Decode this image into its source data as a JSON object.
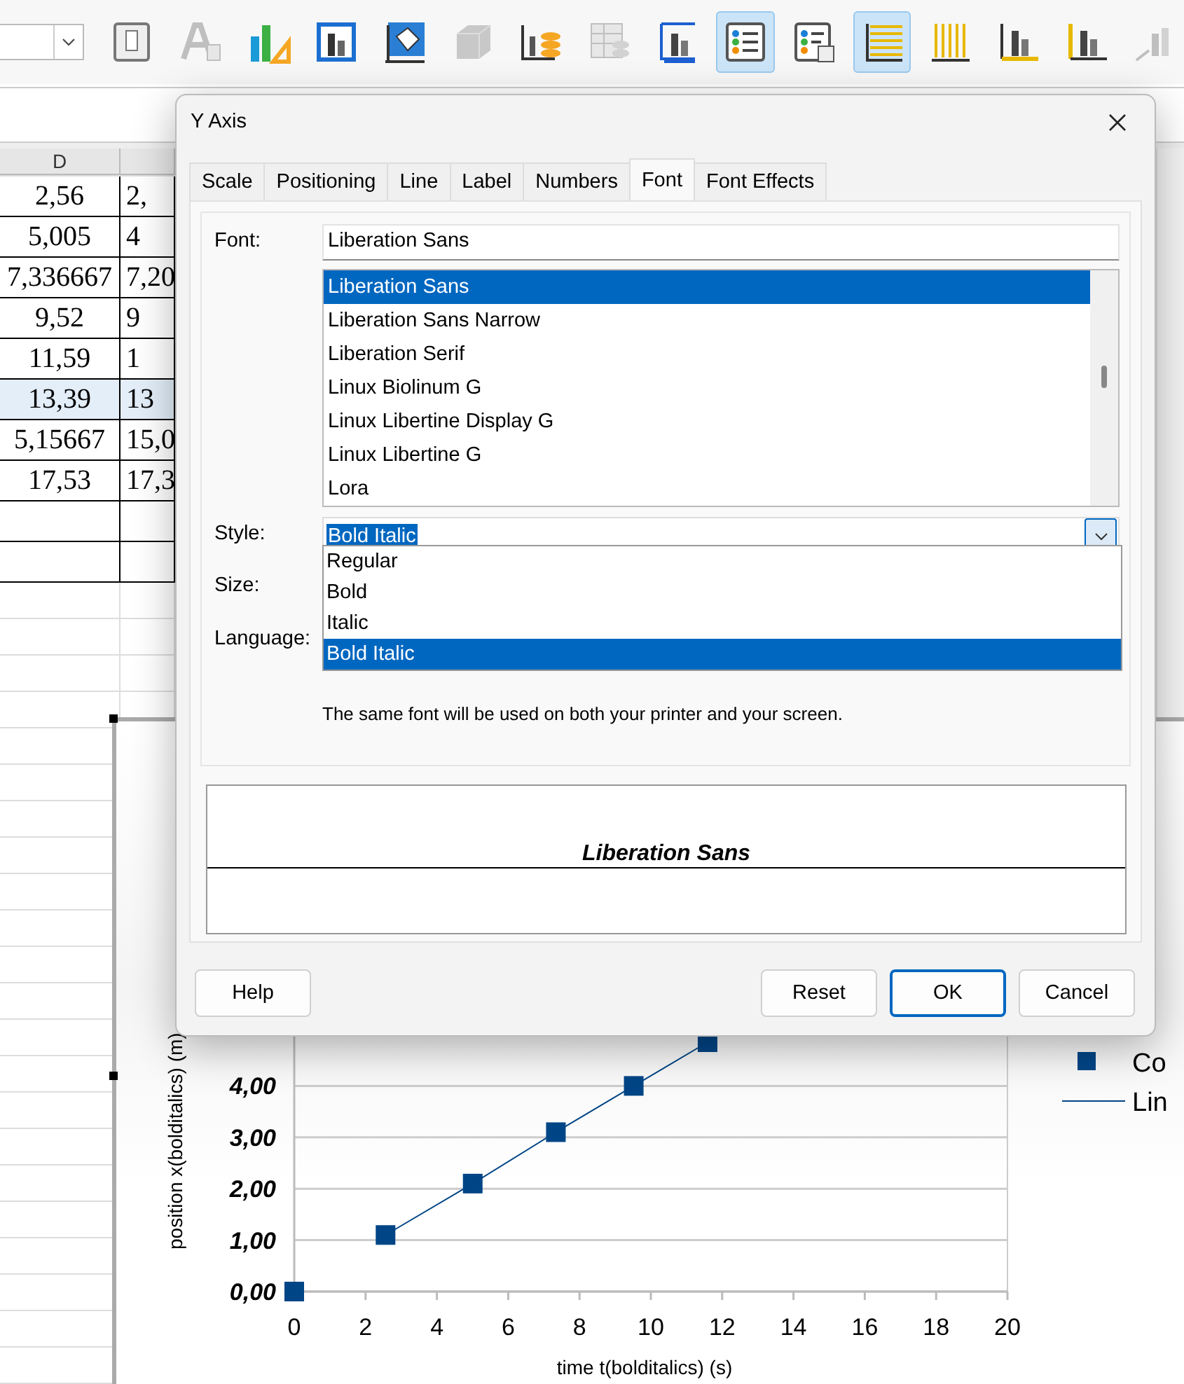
{
  "toolbar": {
    "buttons": [
      {
        "kind": "frame",
        "selected": false,
        "disabled": false
      },
      {
        "kind": "text",
        "selected": false,
        "disabled": true
      },
      {
        "kind": "chart-types",
        "selected": false,
        "disabled": false
      },
      {
        "kind": "chart",
        "selected": false,
        "disabled": false
      },
      {
        "kind": "chart-area",
        "selected": false,
        "disabled": false
      },
      {
        "kind": "cube",
        "selected": false,
        "disabled": true
      },
      {
        "kind": "data-coins",
        "selected": false,
        "disabled": false
      },
      {
        "kind": "data-table",
        "selected": false,
        "disabled": true
      },
      {
        "kind": "axes",
        "selected": false,
        "disabled": false
      },
      {
        "kind": "legend",
        "selected": true,
        "disabled": false
      },
      {
        "kind": "legend-object",
        "selected": false,
        "disabled": false
      },
      {
        "kind": "grid-h",
        "selected": true,
        "disabled": false
      },
      {
        "kind": "grid-v",
        "selected": false,
        "disabled": false
      },
      {
        "kind": "x-axis",
        "selected": false,
        "disabled": false
      },
      {
        "kind": "y-axis",
        "selected": false,
        "disabled": false
      },
      {
        "kind": "z-axis",
        "selected": false,
        "disabled": true
      }
    ]
  },
  "sheet": {
    "columns": [
      "D"
    ],
    "rows": [
      {
        "cells": [
          "2,56",
          "2,"
        ],
        "selected": false
      },
      {
        "cells": [
          "5,005",
          "4"
        ],
        "selected": false
      },
      {
        "cells": [
          "7,336667",
          "7,20"
        ],
        "selected": false
      },
      {
        "cells": [
          "9,52",
          "9"
        ],
        "selected": false
      },
      {
        "cells": [
          "11,59",
          "1"
        ],
        "selected": false
      },
      {
        "cells": [
          "13,39",
          "13"
        ],
        "selected": true
      },
      {
        "cells": [
          "5,15667",
          "15,0"
        ],
        "selected": false
      },
      {
        "cells": [
          "17,53",
          "17,3"
        ],
        "selected": false
      }
    ]
  },
  "chart": {
    "chart_data": {
      "type": "scatter",
      "xlabel": "time t(bolditalics) (s)",
      "ylabel": "position x(bolditalics) (m)",
      "x": [
        0,
        2.56,
        5.005,
        7.336667,
        9.52,
        11.59
      ],
      "series": [
        {
          "name": "Co",
          "color": "#004586",
          "values": [
            0,
            1.1,
            2.1,
            3.1,
            4.0,
            4.85
          ]
        },
        {
          "name": "Lin",
          "color": "#004586",
          "type": "line",
          "values": [
            null,
            1.1,
            2.1,
            3.1,
            4.0,
            4.85
          ]
        }
      ],
      "grid": "y",
      "legend": "right",
      "xlim": [
        0,
        20
      ],
      "ylim": [
        0,
        5
      ],
      "xticks": [
        0,
        2,
        4,
        6,
        8,
        10,
        12,
        14,
        16,
        18,
        20
      ],
      "yticks": [
        {
          "value": 0,
          "label": "0,00"
        },
        {
          "value": 1,
          "label": "1,00"
        },
        {
          "value": 2,
          "label": "2,00"
        },
        {
          "value": 3,
          "label": "3,00"
        },
        {
          "value": 4,
          "label": "4,00"
        }
      ]
    }
  },
  "dialog": {
    "title": "Y Axis",
    "tabs": [
      {
        "label": "Scale",
        "selected": false
      },
      {
        "label": "Positioning",
        "selected": false
      },
      {
        "label": "Line",
        "selected": false
      },
      {
        "label": "Label",
        "selected": false
      },
      {
        "label": "Numbers",
        "selected": false
      },
      {
        "label": "Font",
        "selected": true
      },
      {
        "label": "Font Effects",
        "selected": false
      }
    ],
    "font_label": "Font:",
    "font_value": "Liberation Sans",
    "font_list": [
      {
        "label": "Liberation Sans",
        "selected": true
      },
      {
        "label": "Liberation Sans Narrow",
        "selected": false
      },
      {
        "label": "Liberation Serif",
        "selected": false
      },
      {
        "label": "Linux Biolinum G",
        "selected": false
      },
      {
        "label": "Linux Libertine Display G",
        "selected": false
      },
      {
        "label": "Linux Libertine G",
        "selected": false
      },
      {
        "label": "Lora",
        "selected": false
      }
    ],
    "style_label": "Style:",
    "style_value": "Bold Italic",
    "style_options": [
      {
        "label": "Regular",
        "selected": false
      },
      {
        "label": "Bold",
        "selected": false
      },
      {
        "label": "Italic",
        "selected": false
      },
      {
        "label": "Bold Italic",
        "selected": true
      }
    ],
    "size_label": "Size:",
    "language_label": "Language:",
    "note": "The same font will be used on both your printer and your screen.",
    "preview": "Liberation Sans",
    "help_button": "Help",
    "buttons": [
      {
        "label": "Reset",
        "focused": false
      },
      {
        "label": "OK",
        "focused": true
      },
      {
        "label": "Cancel",
        "focused": false
      }
    ]
  }
}
